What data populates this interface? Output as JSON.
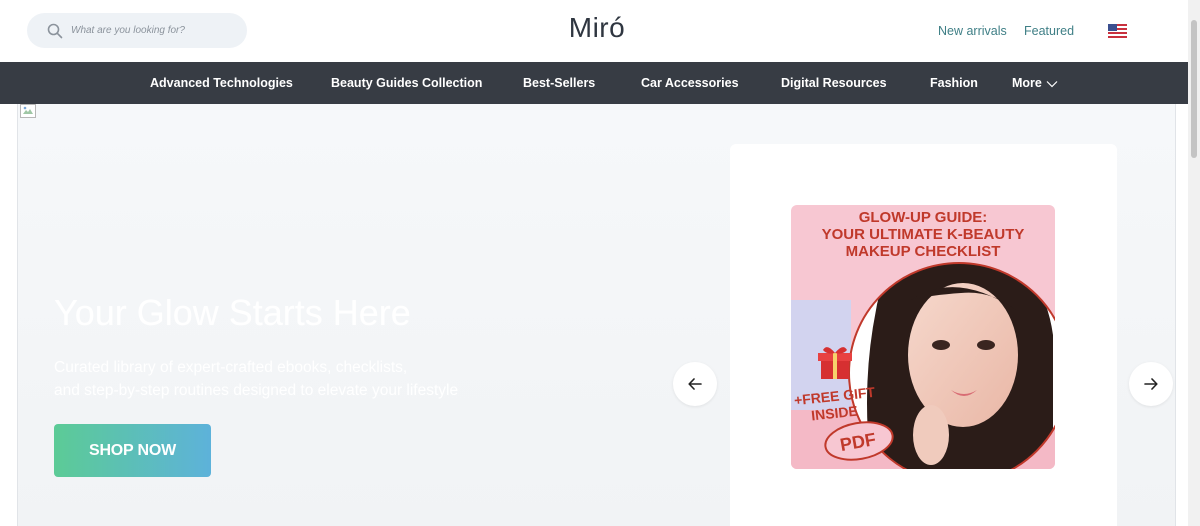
{
  "header": {
    "search_placeholder": "What are you looking for?",
    "logo": "Miró",
    "links": [
      "New arrivals",
      "Featured"
    ]
  },
  "nav": {
    "items": [
      "Advanced Technologies",
      "Beauty Guides Collection",
      "Best-Sellers",
      "Car Accessories",
      "Digital Resources",
      "Fashion"
    ],
    "more_label": "More"
  },
  "hero": {
    "title": "Your Glow Starts Here",
    "subtitle_line1": "Curated library of expert-crafted ebooks, checklists,",
    "subtitle_line2": "and step-by-step routines designed to elevate your lifestyle",
    "cta_label": "SHOP NOW"
  },
  "product": {
    "title_line1": "GLOW-UP GUIDE:",
    "title_line2": "YOUR ULTIMATE K-BEAUTY",
    "title_line3": "MAKEUP CHECKLIST",
    "badge_line1": "+FREE GIFT",
    "badge_line2": "INSIDE",
    "badge_line3": "PDF"
  },
  "colors": {
    "nav_bg": "#373c44",
    "link": "#3f7f86",
    "cta_start": "#5ccb96",
    "cta_end": "#5db2da"
  }
}
